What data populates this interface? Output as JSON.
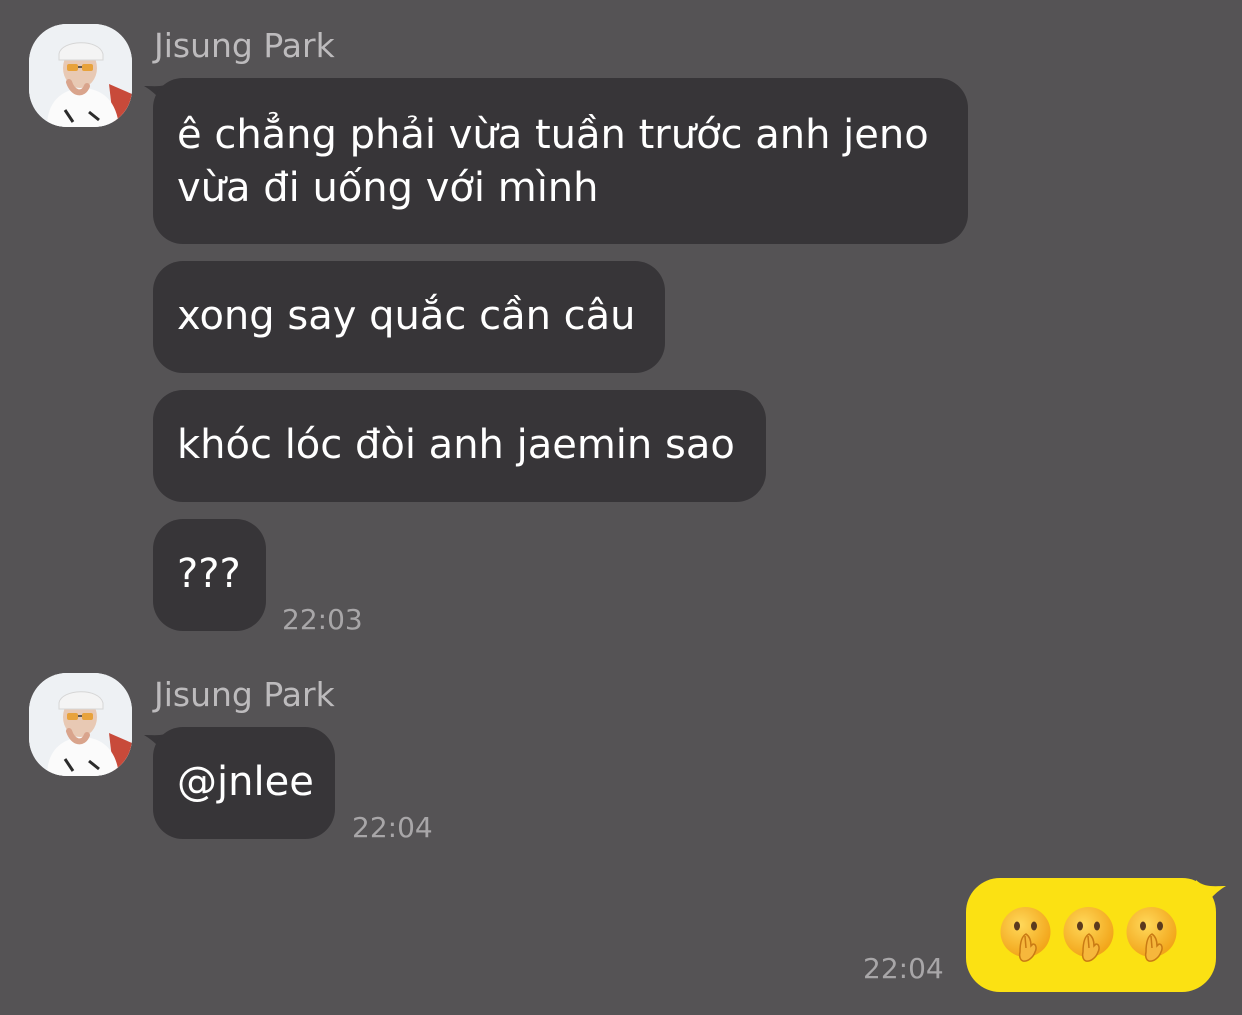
{
  "colors": {
    "background": "#555355",
    "incoming_bubble": "#373538",
    "outgoing_bubble": "#fbe113",
    "sender_name": "#bdbbbd",
    "timestamp": "#a8a6a8"
  },
  "groups": [
    {
      "sender": "Jisung Park",
      "avatar_icon": "profile-photo",
      "messages": [
        {
          "line1": "ê chẳng phải vừa tuần trước anh jeno",
          "line2": "vừa đi uống với mình"
        },
        {
          "text": "xong say quắc cần câu"
        },
        {
          "text": "khóc lóc đòi anh jaemin sao"
        },
        {
          "text": "???"
        }
      ],
      "time": "22:03"
    },
    {
      "sender": "Jisung Park",
      "avatar_icon": "profile-photo",
      "messages": [
        {
          "text": "@jnlee"
        }
      ],
      "time": "22:04"
    }
  ],
  "outgoing": {
    "emoji_icons": [
      "shushing-face-emoji",
      "shushing-face-emoji",
      "shushing-face-emoji"
    ],
    "time": "22:04"
  }
}
